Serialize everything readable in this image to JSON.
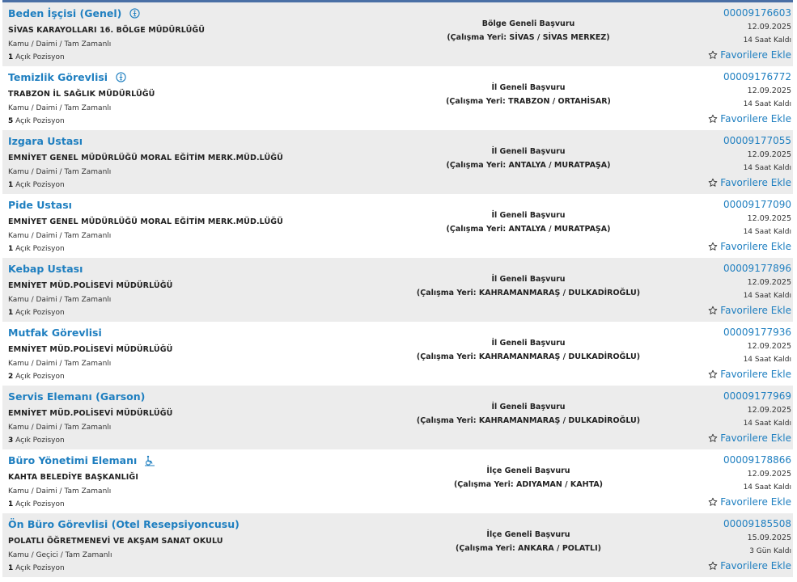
{
  "listings": [
    {
      "title": "Beden İşçisi (Genel)",
      "badge": "disability-quota-icon",
      "org": "SİVAS KARAYOLLARI 16. BÖLGE MÜDÜRLÜĞÜ",
      "type": "Kamu / Daimi / Tam Zamanlı",
      "positions": "1",
      "positions_label": "Açık Pozisyon",
      "scope": "Bölge Geneli Başvuru",
      "location": "(Çalışma Yeri: SİVAS / SİVAS MERKEZ)",
      "number": "00009176603",
      "date": "12.09.2025",
      "remaining": "14 Saat Kaldı",
      "favorite_label": "Favorilere Ekle"
    },
    {
      "title": "Temizlik Görevlisi",
      "badge": "disability-quota-icon",
      "org": "TRABZON İL SAĞLIK MÜDÜRLÜĞÜ",
      "type": "Kamu / Daimi / Tam Zamanlı",
      "positions": "5",
      "positions_label": "Açık Pozisyon",
      "scope": "İl Geneli Başvuru",
      "location": "(Çalışma Yeri: TRABZON / ORTAHİSAR)",
      "number": "00009176772",
      "date": "12.09.2025",
      "remaining": "14 Saat Kaldı",
      "favorite_label": "Favorilere Ekle"
    },
    {
      "title": "Izgara Ustası",
      "badge": "",
      "org": "EMNİYET GENEL MÜDÜRLÜĞÜ MORAL EĞİTİM MERK.MÜD.LÜĞÜ",
      "type": "Kamu / Daimi / Tam Zamanlı",
      "positions": "1",
      "positions_label": "Açık Pozisyon",
      "scope": "İl Geneli Başvuru",
      "location": "(Çalışma Yeri: ANTALYA / MURATPAŞA)",
      "number": "00009177055",
      "date": "12.09.2025",
      "remaining": "14 Saat Kaldı",
      "favorite_label": "Favorilere Ekle"
    },
    {
      "title": "Pide Ustası",
      "badge": "",
      "org": "EMNİYET GENEL MÜDÜRLÜĞÜ MORAL EĞİTİM MERK.MÜD.LÜĞÜ",
      "type": "Kamu / Daimi / Tam Zamanlı",
      "positions": "1",
      "positions_label": "Açık Pozisyon",
      "scope": "İl Geneli Başvuru",
      "location": "(Çalışma Yeri: ANTALYA / MURATPAŞA)",
      "number": "00009177090",
      "date": "12.09.2025",
      "remaining": "14 Saat Kaldı",
      "favorite_label": "Favorilere Ekle"
    },
    {
      "title": "Kebap Ustası",
      "badge": "",
      "org": "EMNİYET MÜD.POLİSEVİ MÜDÜRLÜĞÜ",
      "type": "Kamu / Daimi / Tam Zamanlı",
      "positions": "1",
      "positions_label": "Açık Pozisyon",
      "scope": "İl Geneli Başvuru",
      "location": "(Çalışma Yeri: KAHRAMANMARAŞ / DULKADİROĞLU)",
      "number": "00009177896",
      "date": "12.09.2025",
      "remaining": "14 Saat Kaldı",
      "favorite_label": "Favorilere Ekle"
    },
    {
      "title": "Mutfak Görevlisi",
      "badge": "",
      "org": "EMNİYET MÜD.POLİSEVİ MÜDÜRLÜĞÜ",
      "type": "Kamu / Daimi / Tam Zamanlı",
      "positions": "2",
      "positions_label": "Açık Pozisyon",
      "scope": "İl Geneli Başvuru",
      "location": "(Çalışma Yeri: KAHRAMANMARAŞ / DULKADİROĞLU)",
      "number": "00009177936",
      "date": "12.09.2025",
      "remaining": "14 Saat Kaldı",
      "favorite_label": "Favorilere Ekle"
    },
    {
      "title": "Servis Elemanı (Garson)",
      "badge": "",
      "org": "EMNİYET MÜD.POLİSEVİ MÜDÜRLÜĞÜ",
      "type": "Kamu / Daimi / Tam Zamanlı",
      "positions": "3",
      "positions_label": "Açık Pozisyon",
      "scope": "İl Geneli Başvuru",
      "location": "(Çalışma Yeri: KAHRAMANMARAŞ / DULKADİROĞLU)",
      "number": "00009177969",
      "date": "12.09.2025",
      "remaining": "14 Saat Kaldı",
      "favorite_label": "Favorilere Ekle"
    },
    {
      "title": "Büro Yönetimi Elemanı",
      "badge": "wheelchair-icon",
      "org": "KAHTA BELEDİYE BAŞKANLIĞI",
      "type": "Kamu / Daimi / Tam Zamanlı",
      "positions": "1",
      "positions_label": "Açık Pozisyon",
      "scope": "İlçe Geneli Başvuru",
      "location": "(Çalışma Yeri: ADIYAMAN / KAHTA)",
      "number": "00009178866",
      "date": "12.09.2025",
      "remaining": "14 Saat Kaldı",
      "favorite_label": "Favorilere Ekle"
    },
    {
      "title": "Ön Büro Görevlisi (Otel Resepsiyoncusu)",
      "badge": "",
      "org": "POLATLI ÖĞRETMENEVİ VE AKŞAM SANAT OKULU",
      "type": "Kamu / Geçici / Tam Zamanlı",
      "positions": "1",
      "positions_label": "Açık Pozisyon",
      "scope": "İlçe Geneli Başvuru",
      "location": "(Çalışma Yeri: ANKARA / POLATLI)",
      "number": "00009185508",
      "date": "15.09.2025",
      "remaining": "3 Gün Kaldı",
      "favorite_label": "Favorilere Ekle"
    }
  ],
  "colors": {
    "link": "#1f7fc0",
    "row_alt": "#ececec",
    "top_border": "#4a6fa5"
  }
}
